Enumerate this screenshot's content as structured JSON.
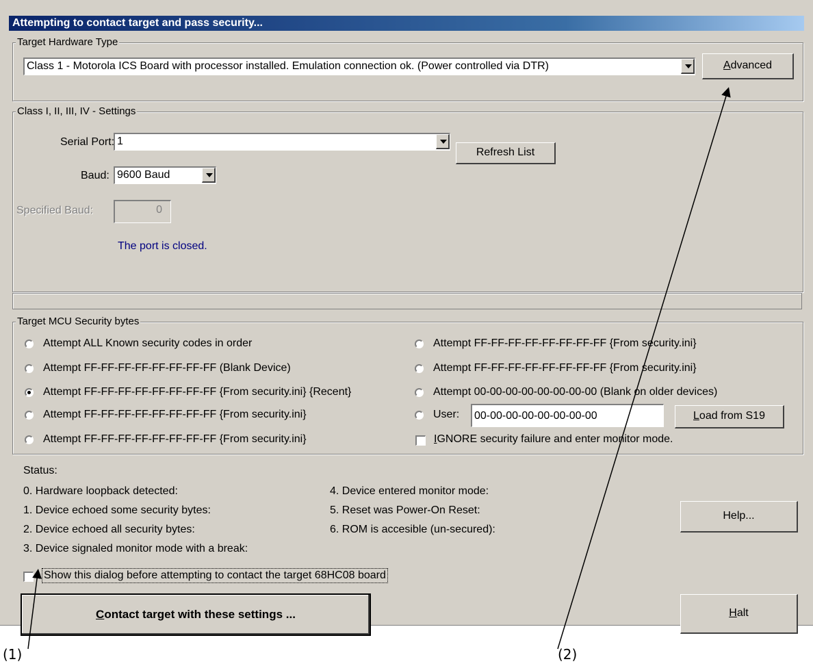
{
  "window": {
    "title": "Attempting to contact target and pass security..."
  },
  "hardware": {
    "legend": "Target Hardware Type",
    "selected": "Class 1 - Motorola ICS Board with processor installed. Emulation connection ok. (Power controlled via DTR)",
    "advanced_mnemonic": "A",
    "advanced_rest": "dvanced"
  },
  "settings": {
    "legend": "Class I, II, III, IV - Settings",
    "serial_port_label": "Serial Port:",
    "serial_port_value": "1",
    "refresh_label": "Refresh List",
    "baud_label": "Baud:",
    "baud_value": "9600 Baud",
    "specified_baud_label": "Specified Baud:",
    "specified_baud_value": "0",
    "port_status": "The port is closed."
  },
  "security": {
    "legend": "Target MCU Security bytes",
    "left_options": [
      "Attempt ALL Known security codes in order",
      "Attempt FF-FF-FF-FF-FF-FF-FF-FF (Blank Device)",
      "Attempt FF-FF-FF-FF-FF-FF-FF-FF {From security.ini} {Recent}",
      "Attempt FF-FF-FF-FF-FF-FF-FF-FF {From security.ini}",
      "Attempt FF-FF-FF-FF-FF-FF-FF-FF {From security.ini}"
    ],
    "right_options": [
      "Attempt FF-FF-FF-FF-FF-FF-FF-FF {From security.ini}",
      "Attempt FF-FF-FF-FF-FF-FF-FF-FF {From security.ini}",
      "Attempt 00-00-00-00-00-00-00-00 (Blank on older devices)"
    ],
    "user_label": "User:",
    "user_value": "00-00-00-00-00-00-00-00",
    "load_mnemonic": "L",
    "load_rest": "oad from S19",
    "ignore_mnemonic": "I",
    "ignore_rest": "GNORE security failure and enter monitor mode."
  },
  "status": {
    "label": "Status:",
    "left_items": [
      "0. Hardware loopback detected:",
      "1. Device echoed some security bytes:",
      "2. Device echoed all security bytes:",
      "3. Device signaled monitor mode with a break:"
    ],
    "right_items": [
      "4. Device entered monitor mode:",
      "5. Reset was Power-On Reset:",
      "6. ROM is accesible (un-secured):"
    ]
  },
  "help_label": "Help...",
  "show_dialog_label": "Show this dialog before attempting to contact the target 68HC08 board",
  "contact_mnemonic": "C",
  "contact_rest": "ontact target with these settings ...",
  "halt_mnemonic": "H",
  "halt_rest": "alt",
  "annotations": {
    "one": "(1)",
    "two": "(2)"
  }
}
